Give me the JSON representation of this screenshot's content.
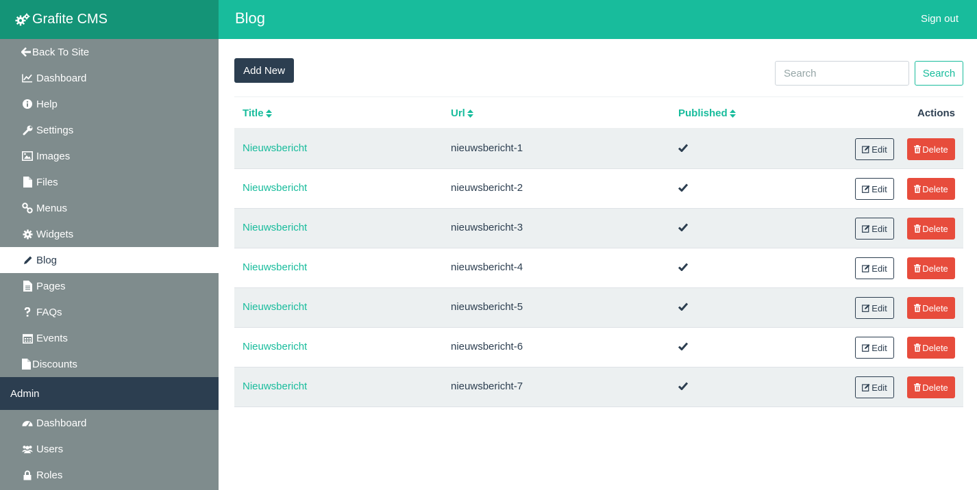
{
  "brand": {
    "name": "Grafite CMS",
    "icon": "cogs-icon"
  },
  "sidebar": {
    "items": [
      {
        "label": "Back To Site",
        "icon": "arrow-left-icon",
        "name": "sidebar-item-back-to-site"
      },
      {
        "label": "Dashboard",
        "icon": "line-chart-icon",
        "name": "sidebar-item-dashboard"
      },
      {
        "label": "Help",
        "icon": "info-circle-icon",
        "name": "sidebar-item-help"
      },
      {
        "label": "Settings",
        "icon": "wrench-icon",
        "name": "sidebar-item-settings"
      },
      {
        "label": "Images",
        "icon": "image-icon",
        "name": "sidebar-item-images"
      },
      {
        "label": "Files",
        "icon": "file-icon",
        "name": "sidebar-item-files"
      },
      {
        "label": "Menus",
        "icon": "link-icon",
        "name": "sidebar-item-menus"
      },
      {
        "label": "Widgets",
        "icon": "gear-icon",
        "name": "sidebar-item-widgets"
      },
      {
        "label": "Blog",
        "icon": "pencil-icon",
        "name": "sidebar-item-blog",
        "active": true
      },
      {
        "label": "Pages",
        "icon": "file-text-icon",
        "name": "sidebar-item-pages"
      },
      {
        "label": "FAQs",
        "icon": "question-icon",
        "name": "sidebar-item-faqs"
      },
      {
        "label": "Events",
        "icon": "calendar-icon",
        "name": "sidebar-item-events"
      },
      {
        "label": "Discounts",
        "icon": "file-icon",
        "name": "sidebar-item-discounts"
      }
    ],
    "admin_header": "Admin",
    "admin_items": [
      {
        "label": "Dashboard",
        "icon": "dashboard-icon",
        "name": "admin-item-dashboard"
      },
      {
        "label": "Users",
        "icon": "users-icon",
        "name": "admin-item-users"
      },
      {
        "label": "Roles",
        "icon": "lock-icon",
        "name": "admin-item-roles"
      }
    ]
  },
  "header": {
    "title": "Blog",
    "signout_label": "Sign out"
  },
  "toolbar": {
    "add_label": "Add New",
    "search_placeholder": "Search",
    "search_value": "",
    "search_button_label": "Search"
  },
  "table": {
    "columns": {
      "title": "Title",
      "url": "Url",
      "published": "Published",
      "actions": "Actions"
    },
    "edit_label": "Edit",
    "delete_label": "Delete",
    "rows": [
      {
        "title": "Nieuwsbericht",
        "url": "nieuwsbericht-1",
        "published": true
      },
      {
        "title": "Nieuwsbericht",
        "url": "nieuwsbericht-2",
        "published": true
      },
      {
        "title": "Nieuwsbericht",
        "url": "nieuwsbericht-3",
        "published": true
      },
      {
        "title": "Nieuwsbericht",
        "url": "nieuwsbericht-4",
        "published": true
      },
      {
        "title": "Nieuwsbericht",
        "url": "nieuwsbericht-5",
        "published": true
      },
      {
        "title": "Nieuwsbericht",
        "url": "nieuwsbericht-6",
        "published": true
      },
      {
        "title": "Nieuwsbericht",
        "url": "nieuwsbericht-7",
        "published": true
      }
    ]
  },
  "colors": {
    "brand_dark": "#149477",
    "primary": "#18bc9c",
    "sidebar": "#7f8c8d",
    "dark": "#2c3e50",
    "danger": "#e74c3c",
    "stripe": "#ecf0f1"
  }
}
